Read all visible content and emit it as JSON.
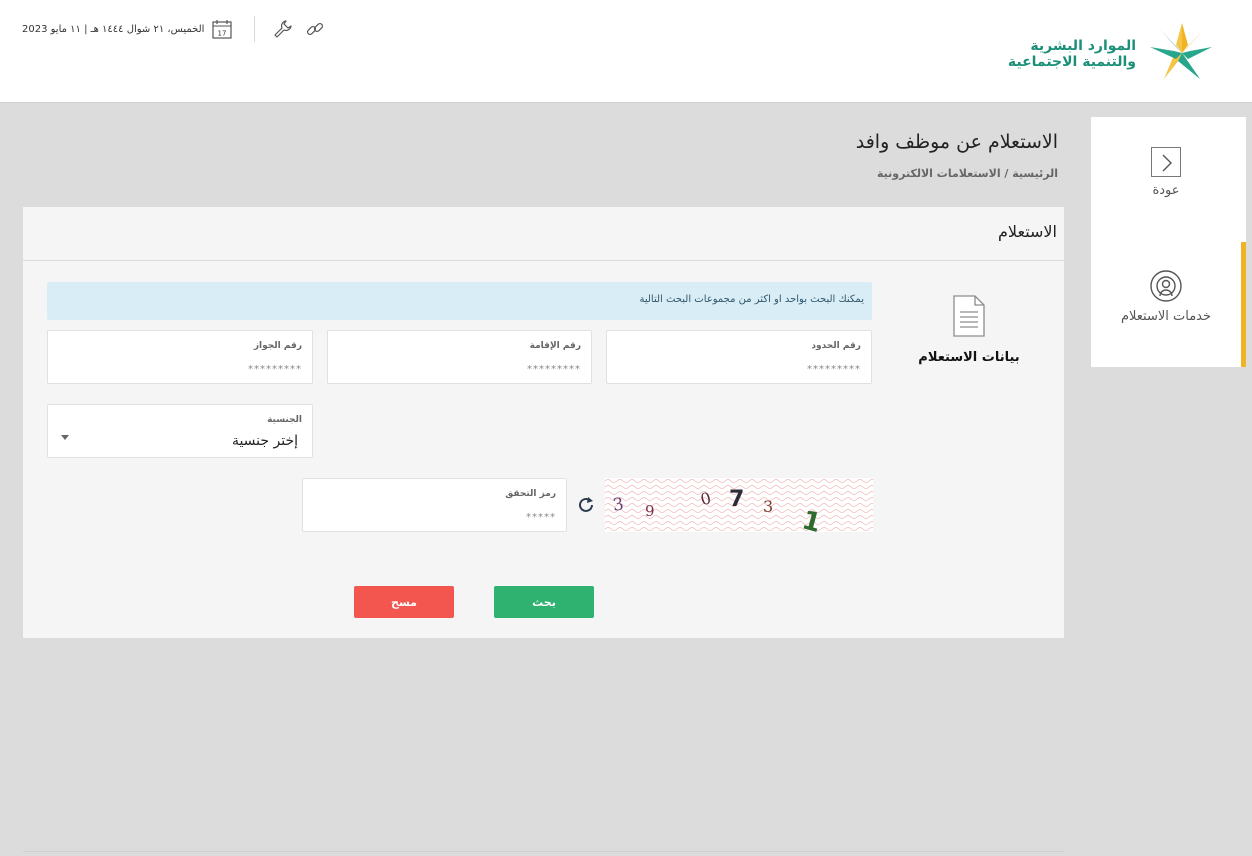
{
  "header": {
    "logo_line1": "الموارد البشرية",
    "logo_line2": "والتنمية الاجتماعية",
    "date_text": "الخميس، ٢١ شوال ١٤٤٤ هـ | ١١ مايو 2023",
    "calendar_day": "17"
  },
  "sidebar": {
    "back_label": "عودة",
    "services_label": "خدمات الاستعلام"
  },
  "page": {
    "title": "الاستعلام عن موظف وافد",
    "breadcrumb": "الرئيسية / الاستعلامات الالكترونية"
  },
  "panel": {
    "title": "الاستعلام",
    "data_label": "بيانات الاستعلام",
    "info": "يمكنك البحث بواحد او اكثر من مجموعات البحث التالية",
    "border_label": "رقم الحدود",
    "border_placeholder": "*********",
    "iqama_label": "رقم الإقامة",
    "iqama_placeholder": "*********",
    "passport_label": "رقم الجواز",
    "passport_placeholder": "*********",
    "nationality_label": "الجنسية",
    "nationality_value": "إختر جنسية",
    "captcha_label": "رمز التحقق",
    "captcha_placeholder": "*****",
    "captcha_chars": [
      "3",
      "9",
      "0",
      "7",
      "3",
      "1"
    ],
    "search_button": "بحث",
    "clear_button": "مسح"
  },
  "colors": {
    "accent_yellow": "#f0b323",
    "search_green": "#2fb270",
    "clear_red": "#f2564f",
    "brand_teal": "#1c8f79"
  }
}
